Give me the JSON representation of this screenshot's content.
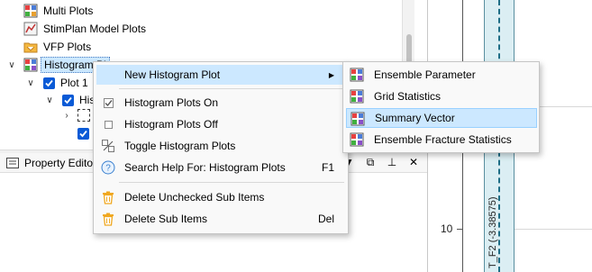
{
  "tree": {
    "items": [
      {
        "label": "Multi Plots"
      },
      {
        "label": "StimPlan Model Plots"
      },
      {
        "label": "VFP Plots"
      },
      {
        "label": "Histogram Pl"
      },
      {
        "label": "Plot 1"
      },
      {
        "label": "His"
      }
    ]
  },
  "property_editor": {
    "title": "Property Edito",
    "buttons": {
      "menu": "▼",
      "float": "⧉",
      "pin": "⊥",
      "close": "✕"
    }
  },
  "plot": {
    "tick_label": "10",
    "vertical_label": "T_F2 (-3.38575)"
  },
  "context_menu": {
    "items": [
      {
        "label": "New Histogram Plot",
        "shortcut": "",
        "has_submenu": true,
        "icon": "none"
      },
      {
        "label": "Histogram Plots On",
        "shortcut": "",
        "icon": "checked-box-icon"
      },
      {
        "label": "Histogram Plots Off",
        "shortcut": "",
        "icon": "unchecked-box-icon"
      },
      {
        "label": "Toggle Histogram Plots",
        "shortcut": "",
        "icon": "toggle-icon"
      },
      {
        "label": "Search Help For: Histogram Plots",
        "shortcut": "F1",
        "icon": "help-icon"
      },
      {
        "label": "Delete Unchecked Sub Items",
        "shortcut": "",
        "icon": "trash-icon"
      },
      {
        "label": "Delete Sub Items",
        "shortcut": "Del",
        "icon": "trash-icon"
      }
    ]
  },
  "submenu": {
    "items": [
      {
        "label": "Ensemble Parameter"
      },
      {
        "label": "Grid Statistics"
      },
      {
        "label": "Summary Vector"
      },
      {
        "label": "Ensemble Fracture Statistics"
      }
    ]
  },
  "colors": {
    "highlight": "#cce8ff",
    "checkbox": "#0a5ad6",
    "plot_band": "#dbeef3",
    "plot_line": "#1f6e86"
  }
}
